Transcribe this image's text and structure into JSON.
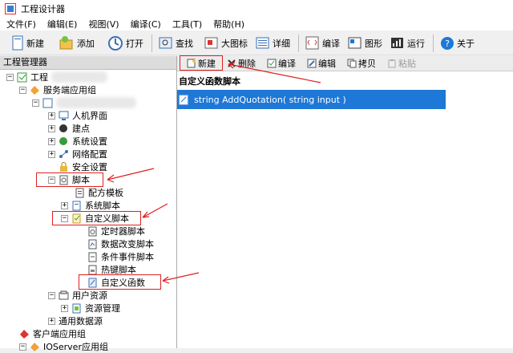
{
  "window": {
    "title": "工程设计器"
  },
  "menu": [
    "文件(F)",
    "编辑(E)",
    "视图(V)",
    "编译(C)",
    "工具(T)",
    "帮助(H)"
  ],
  "toolbar": [
    {
      "label": "新建",
      "icon": "new-icon"
    },
    {
      "label": "添加",
      "icon": "add-icon"
    },
    {
      "label": "打开",
      "icon": "open-icon"
    },
    {
      "label": "查找",
      "icon": "find-icon"
    },
    {
      "label": "大图标",
      "icon": "large-icon"
    },
    {
      "label": "详细",
      "icon": "detail-icon"
    },
    {
      "label": "编译",
      "icon": "compile-icon"
    },
    {
      "label": "图形",
      "icon": "graphics-icon"
    },
    {
      "label": "运行",
      "icon": "run-icon"
    },
    {
      "label": "关于",
      "icon": "help-icon"
    }
  ],
  "left": {
    "header": "工程管理器",
    "tree": {
      "root": "工程",
      "server_group": "服务端应用组",
      "hmi": "人机界面",
      "points": "建点",
      "system_settings": "系统设置",
      "network": "网络配置",
      "security": "安全设置",
      "scripts": "脚本",
      "recipe_template": "配方模板",
      "system_script": "系统脚本",
      "custom_script": "自定义脚本",
      "timer_script": "定时器脚本",
      "data_change_script": "数据改变脚本",
      "condition_script": "条件事件脚本",
      "hotkey_script": "热键脚本",
      "custom_function": "自定义函数",
      "user_resources": "用户资源",
      "resource_manager": "资源管理",
      "common_datasource": "通用数据源",
      "client_group": "客户端应用组",
      "ioserver_group": "IOServer应用组"
    }
  },
  "right": {
    "toolbar": {
      "new": "新建",
      "delete": "删除",
      "compile": "编译",
      "edit": "编辑",
      "copy": "拷贝",
      "paste": "粘贴"
    },
    "section_title": "自定义函数脚本",
    "function_item": "string AddQuotation( string input )"
  },
  "colors": {
    "selection": "#1e78d7",
    "annotation": "#e02020"
  }
}
